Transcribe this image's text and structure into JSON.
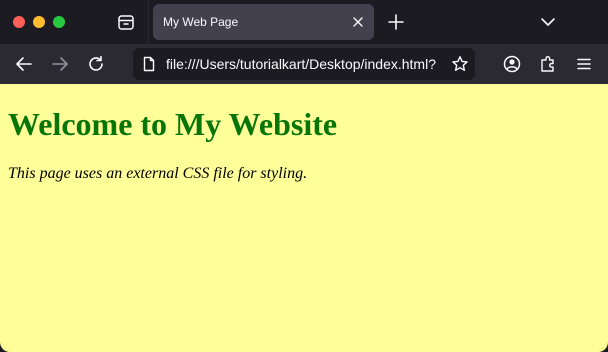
{
  "tabs": [
    {
      "title": "My Web Page",
      "active": true
    }
  ],
  "address_bar": {
    "url": "file:///Users/tutorialkart/Desktop/index.html?"
  },
  "page": {
    "heading": "Welcome to My Website",
    "paragraph": "This page uses an external CSS file for styling.",
    "background": "#ffff99",
    "heading_color": "#087508"
  },
  "icons": {
    "window_controls": [
      "close",
      "minimize",
      "zoom"
    ],
    "tabbar": [
      "tab-overview-icon",
      "close-icon",
      "plus-icon",
      "chevron-down-icon"
    ],
    "navbar": [
      "back-arrow-icon",
      "forward-arrow-icon",
      "reload-icon",
      "page-icon",
      "star-icon",
      "account-icon",
      "extensions-icon",
      "menu-icon"
    ]
  }
}
